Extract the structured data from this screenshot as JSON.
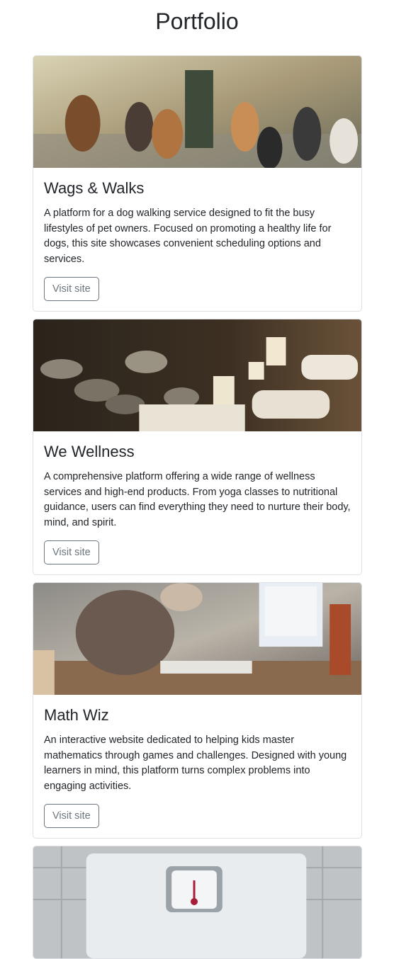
{
  "page": {
    "title": "Portfolio"
  },
  "projects": [
    {
      "title": "Wags & Walks",
      "description": "A platform for a dog walking service designed to fit the busy lifestyles of pet owners. Focused on promoting a healthy life for dogs, this site showcases convenient scheduling options and services.",
      "button_label": "Visit site"
    },
    {
      "title": "We Wellness",
      "description": "A comprehensive platform offering a wide range of wellness services and high-end products. From yoga classes to nutritional guidance, users can find everything they need to nurture their body, mind, and spirit.",
      "button_label": "Visit site"
    },
    {
      "title": "Math Wiz",
      "description": "An interactive website dedicated to helping kids master mathematics through games and challenges. Designed with young learners in mind, this platform turns complex problems into engaging activities.",
      "button_label": "Visit site"
    },
    {
      "title": "",
      "description": "",
      "button_label": ""
    }
  ]
}
